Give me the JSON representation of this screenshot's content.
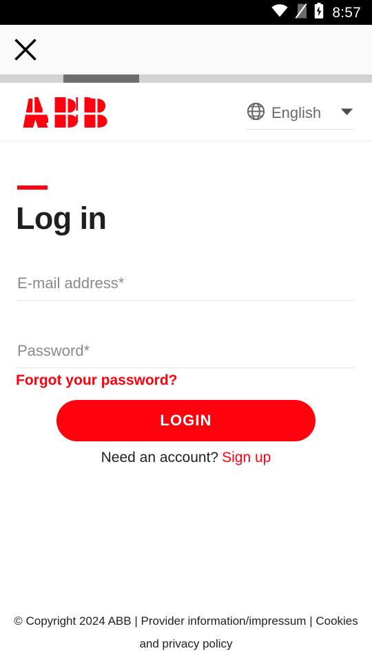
{
  "status_bar": {
    "time": "8:57",
    "icons": [
      "wifi-icon",
      "no-sim-icon",
      "battery-charging-icon"
    ]
  },
  "chrome_bar": {
    "close_label": "close-icon"
  },
  "progress": {
    "value_percent": 37
  },
  "header": {
    "logo_alt": "ABB",
    "language": {
      "selected": "English",
      "icon": "globe-icon",
      "caret": "chevron-down-icon"
    }
  },
  "main": {
    "title": "Log in",
    "email": {
      "placeholder": "E-mail address*",
      "value": ""
    },
    "password": {
      "placeholder": "Password*",
      "value": ""
    },
    "forgot_password": "Forgot your password?",
    "login_button": "LOGIN",
    "signup_prompt": "Need an account?",
    "signup_link": "Sign up"
  },
  "footer": {
    "copyright": "© Copyright 2024 ABB",
    "separator_1": "|",
    "provider": "Provider information/impressum",
    "separator_2": "|",
    "cookies": "Cookies and privacy policy"
  },
  "colors": {
    "brand_red": "#ff000f",
    "button_red": "#ff000d",
    "text_dark": "#1f1f1f",
    "text_muted": "#8a8a8a",
    "status_bar_bg": "#000000",
    "chrome_bg": "#fafafa",
    "progress_track": "#d3d3d3",
    "progress_thumb": "#6e6e6e"
  }
}
